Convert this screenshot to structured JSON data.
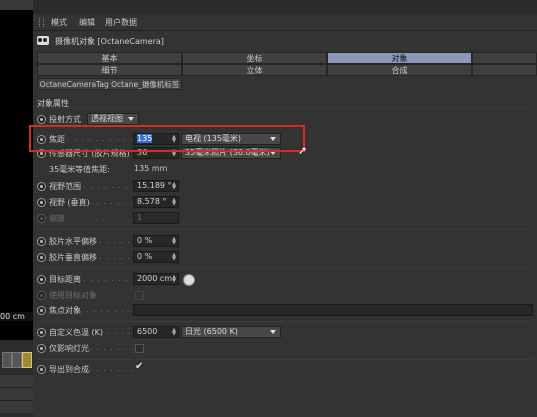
{
  "viewport": {
    "coord_label": "00 cm"
  },
  "menu": {
    "items": [
      "模式",
      "编辑",
      "用户数据"
    ]
  },
  "title": {
    "text": "摄像机对象 [OctaneCamera]"
  },
  "tabs": {
    "row1": [
      "基本",
      "坐标",
      "对象"
    ],
    "row2": [
      "细节",
      "立体",
      "合成"
    ],
    "row3": [
      "OctaneCameraTag Octane_摄像机标签"
    ]
  },
  "section": {
    "title": "对象属性"
  },
  "projection": {
    "label": "投射方式",
    "value": "透视视图"
  },
  "focal": {
    "label": "焦距",
    "value": "135",
    "preset": "电视 (135毫米)"
  },
  "sensor": {
    "label": "传感器尺寸 (胶片规格)",
    "value": "36",
    "preset": "35毫米照片 (36.0毫米)"
  },
  "equiv": {
    "label": "35毫米等值焦距:",
    "value": "135 mm"
  },
  "fov_h": {
    "label": "视野范围",
    "value": "15.189 °"
  },
  "fov_v": {
    "label": "视野 (垂直)",
    "value": "8.578 °"
  },
  "zoom": {
    "label": "缩放",
    "value": "1"
  },
  "film_h": {
    "label": "胶片水平偏移",
    "value": "0 %"
  },
  "film_v": {
    "label": "胶片垂直偏移",
    "value": "0 %"
  },
  "target_dist": {
    "label": "目标距离",
    "value": "2000 cm"
  },
  "use_target": {
    "label": "使用目标对象"
  },
  "focus_obj": {
    "label": "焦点对象"
  },
  "white_balance": {
    "label": "自定义色温 (K)",
    "value": "6500",
    "preset": "日光 (6500 K)"
  },
  "affect_lights": {
    "label": "仅影响灯光"
  },
  "export": {
    "label": "导出到合成",
    "mark": "✔"
  },
  "icons": {
    "cursor": "arrow-cursor-icon",
    "pick": "pick-target-icon"
  },
  "colors": {
    "active_tab": "#8b97b6",
    "highlight": "#e02525"
  }
}
